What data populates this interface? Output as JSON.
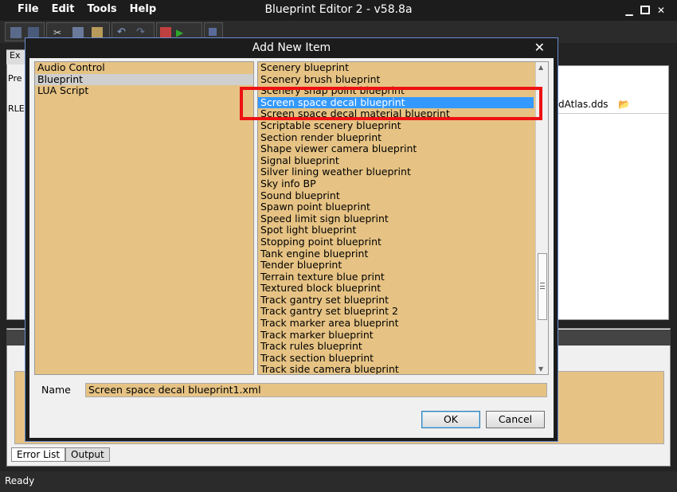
{
  "app": {
    "title": "Blueprint Editor 2 - v58.8a",
    "menu": [
      "File",
      "Edit",
      "Tools",
      "Help"
    ],
    "status": "Ready"
  },
  "background": {
    "left_tab": "Ex",
    "left_label_1": "Pre",
    "left_label_2": "RLE",
    "right_file": "dAtlas.dds",
    "bottom_tabs": [
      "Error List",
      "Output"
    ]
  },
  "dialog": {
    "title": "Add New Item",
    "close_glyph": "✕",
    "categories": [
      "Audio Control",
      "Blueprint",
      "LUA Script"
    ],
    "selected_category": "Blueprint",
    "items": [
      "Scenery blueprint",
      "Scenery brush blueprint",
      "Scenery snap point blueprint",
      "Screen space decal blueprint",
      "Screen space decal material blueprint",
      "Scriptable scenery blueprint",
      "Section render blueprint",
      "Shape viewer camera blueprint",
      "Signal blueprint",
      "Silver lining weather blueprint",
      "Sky info BP",
      "Sound blueprint",
      "Spawn point blueprint",
      "Speed limit sign blueprint",
      "Spot light blueprint",
      "Stopping point blueprint",
      "Tank engine blueprint",
      "Tender blueprint",
      "Terrain texture blue print",
      "Textured block blueprint",
      "Track gantry set blueprint",
      "Track gantry set blueprint 2",
      "Track marker area blueprint",
      "Track marker blueprint",
      "Track rules blueprint",
      "Track section blueprint",
      "Track side camera blueprint"
    ],
    "selected_item_index": 3,
    "name_label": "Name",
    "name_value": "Screen space decal blueprint1.xml",
    "ok_label": "OK",
    "cancel_label": "Cancel"
  },
  "colors": {
    "list_bg": "#e6c384",
    "selection": "#3399ff",
    "highlight": "#ee1111"
  }
}
